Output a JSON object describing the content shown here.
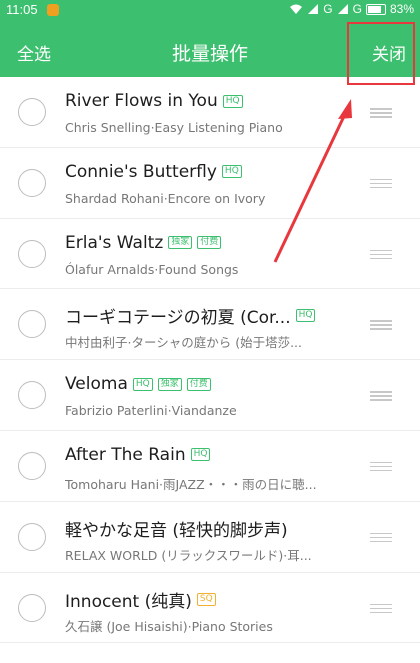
{
  "status_bar": {
    "time": "11:05",
    "battery": "83%",
    "signal_label": "G"
  },
  "header": {
    "select_all": "全选",
    "title": "批量操作",
    "close": "关闭"
  },
  "songs": [
    {
      "title": "River Flows in You",
      "tags": [
        "HQ"
      ],
      "subtitle": "Chris Snelling·Easy Listening Piano"
    },
    {
      "title": "Connie's Butterfly",
      "tags": [
        "HQ"
      ],
      "subtitle": "Shardad Rohani·Encore on Ivory"
    },
    {
      "title": "Erla's Waltz",
      "tags": [
        "独家",
        "付费"
      ],
      "subtitle": "Ólafur Arnalds·Found Songs"
    },
    {
      "title": "コーギコテージの初夏 (Cor...",
      "tags": [
        "HQ"
      ],
      "subtitle": "中村由利子·ターシャの庭から (始于塔莎..."
    },
    {
      "title": "Veloma",
      "tags": [
        "HQ",
        "独家",
        "付费"
      ],
      "subtitle": "Fabrizio Paterlini·Viandanze"
    },
    {
      "title": "After The Rain",
      "tags": [
        "HQ"
      ],
      "subtitle": "Tomoharu Hani·雨JAZZ・・・雨の日に聴..."
    },
    {
      "title": "軽やかな足音 (轻快的脚步声)",
      "tags": [],
      "subtitle": "RELAX WORLD (リラックスワールド)·耳..."
    },
    {
      "title": "Innocent (纯真)",
      "tags": [
        "SQ"
      ],
      "subtitle": "久石譲 (Joe Hisaishi)·Piano Stories"
    }
  ],
  "colors": {
    "accent": "#3cbf6e",
    "highlight": "#e8383d",
    "sq_tag": "#f0b030"
  }
}
